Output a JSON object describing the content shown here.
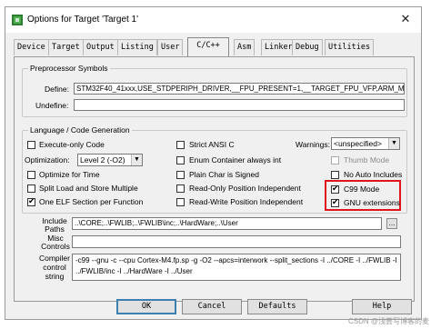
{
  "window": {
    "title": "Options for Target 'Target 1'",
    "close": "✕"
  },
  "tabs": [
    "Device",
    "Target",
    "Output",
    "Listing",
    "User",
    "C/C++",
    "Asm",
    "Linker",
    "Debug",
    "Utilities"
  ],
  "active_tab": "C/C++",
  "preprocessor": {
    "group_title": "Preprocessor Symbols",
    "define_label": "Define:",
    "define_value": "STM32F40_41xxx,USE_STDPERIPH_DRIVER,__FPU_PRESENT=1,__TARGET_FPU_VFP,ARM_MAT",
    "undefine_label": "Undefine:",
    "undefine_value": ""
  },
  "language": {
    "group_title": "Language / Code Generation",
    "execute_only": {
      "label": "Execute-only Code",
      "checked": false
    },
    "optimization_label": "Optimization:",
    "optimization_value": "Level 2 (-O2)",
    "optimize_time": {
      "label": "Optimize for Time",
      "checked": false
    },
    "split_load": {
      "label": "Split Load and Store Multiple",
      "checked": false
    },
    "one_elf": {
      "label": "One ELF Section per Function",
      "checked": true
    },
    "strict_ansi": {
      "label": "Strict ANSI C",
      "checked": false
    },
    "enum_int": {
      "label": "Enum Container always int",
      "checked": false
    },
    "plain_char": {
      "label": "Plain Char is Signed",
      "checked": false
    },
    "ro_pos": {
      "label": "Read-Only Position Independent",
      "checked": false
    },
    "rw_pos": {
      "label": "Read-Write Position Independent",
      "checked": false
    },
    "warnings_label": "Warnings:",
    "warnings_value": "<unspecified>",
    "thumb_mode": {
      "label": "Thumb Mode",
      "checked": false
    },
    "no_auto_includes": {
      "label": "No Auto Includes",
      "checked": false
    },
    "c99_mode": {
      "label": "C99 Mode",
      "checked": true
    },
    "gnu_ext": {
      "label": "GNU extensions",
      "checked": true
    }
  },
  "include": {
    "label_line1": "Include",
    "label_line2": "Paths",
    "value": "..\\CORE;..\\FWLIB;..\\FWLIB\\inc;..\\HardWare;..\\User",
    "browse": "..."
  },
  "misc": {
    "label_line1": "Misc",
    "label_line2": "Controls",
    "value": ""
  },
  "compiler": {
    "label_line1": "Compiler",
    "label_line2": "control",
    "label_line3": "string",
    "line1": "-c99 --gnu -c --cpu Cortex-M4.fp.sp -g -O2 --apcs=interwork --split_sections -I ../CORE -I ../FWLIB -I",
    "line2": "../FWLIB/inc -I ../HardWare -I ../User"
  },
  "buttons": {
    "ok": "OK",
    "cancel": "Cancel",
    "defaults": "Defaults",
    "help": "Help"
  },
  "watermark": "CSDN @浅尝写博客的麦",
  "colors": {
    "highlight": "#e0151c",
    "default_button_border": "#3c7fb1"
  }
}
